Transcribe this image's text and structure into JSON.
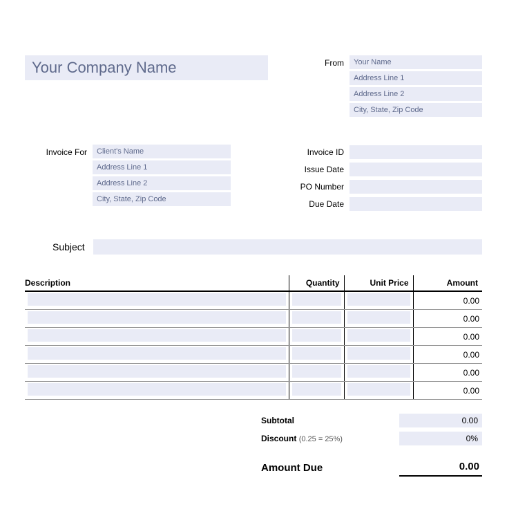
{
  "company_name": "Your Company Name",
  "from": {
    "label": "From",
    "name": "Your Name",
    "addr1": "Address Line 1",
    "addr2": "Address Line 2",
    "city": "City, State, Zip Code"
  },
  "invoice_for": {
    "label": "Invoice For",
    "name": "Client's Name",
    "addr1": "Address Line 1",
    "addr2": "Address Line 2",
    "city": "City, State, Zip Code"
  },
  "meta": {
    "invoice_id": {
      "label": "Invoice ID",
      "value": ""
    },
    "issue_date": {
      "label": "Issue Date",
      "value": ""
    },
    "po_number": {
      "label": "PO Number",
      "value": ""
    },
    "due_date": {
      "label": "Due Date",
      "value": ""
    }
  },
  "subject": {
    "label": "Subject",
    "value": ""
  },
  "columns": {
    "description": "Description",
    "quantity": "Quantity",
    "unit_price": "Unit Price",
    "amount": "Amount"
  },
  "rows": [
    {
      "amount": "0.00"
    },
    {
      "amount": "0.00"
    },
    {
      "amount": "0.00"
    },
    {
      "amount": "0.00"
    },
    {
      "amount": "0.00"
    },
    {
      "amount": "0.00"
    }
  ],
  "totals": {
    "subtotal": {
      "label": "Subtotal",
      "value": "0.00"
    },
    "discount": {
      "label": "Discount",
      "hint": "(0.25 = 25%)",
      "value": "0%"
    },
    "amount_due": {
      "label": "Amount Due",
      "value": "0.00"
    }
  }
}
